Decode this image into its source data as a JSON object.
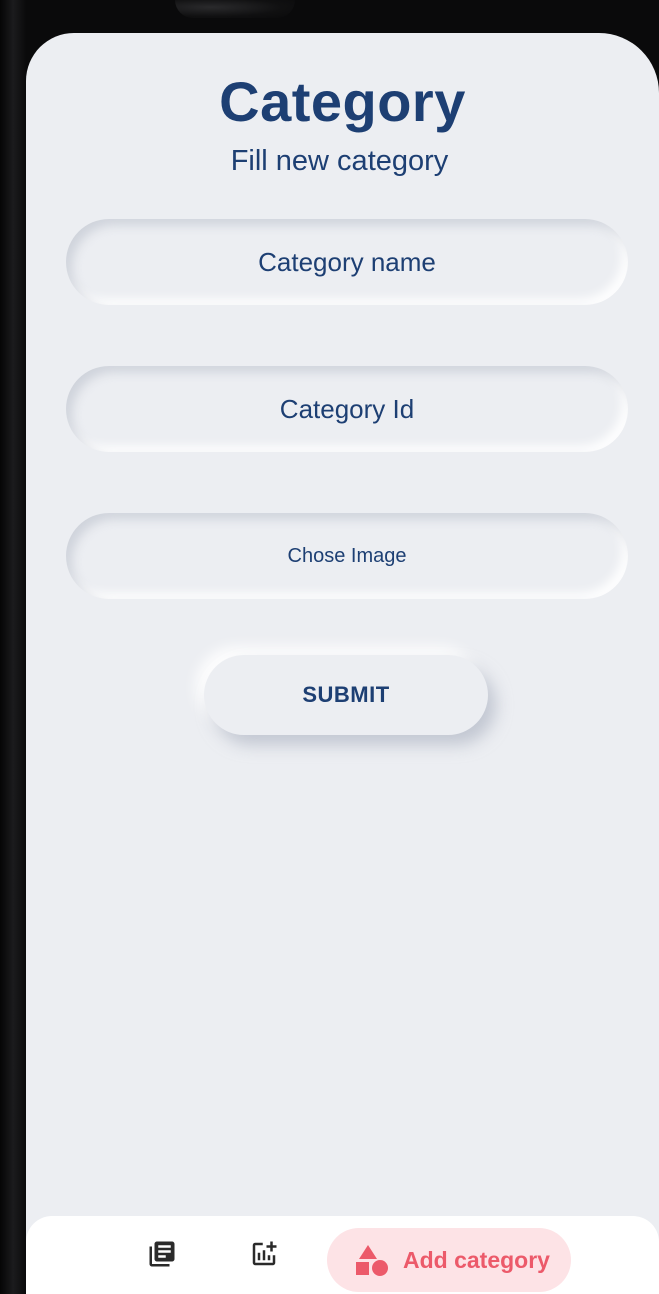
{
  "header": {
    "title": "Category",
    "subtitle": "Fill new category"
  },
  "form": {
    "category_name_placeholder": "Category name",
    "category_id_placeholder": "Category Id",
    "choose_image_label": "Chose Image",
    "submit_label": "SUBMIT"
  },
  "bottom_nav": {
    "items": [
      {
        "icon": "library-books-icon",
        "active": false
      },
      {
        "icon": "add-chart-icon",
        "active": false
      },
      {
        "icon": "shapes-icon",
        "label": "Add category",
        "active": true
      }
    ]
  },
  "colors": {
    "primary_text": "#1d3f73",
    "background": "#eceef2",
    "active_accent": "#ec5a6a",
    "active_pill_bg": "#fde3e6"
  }
}
